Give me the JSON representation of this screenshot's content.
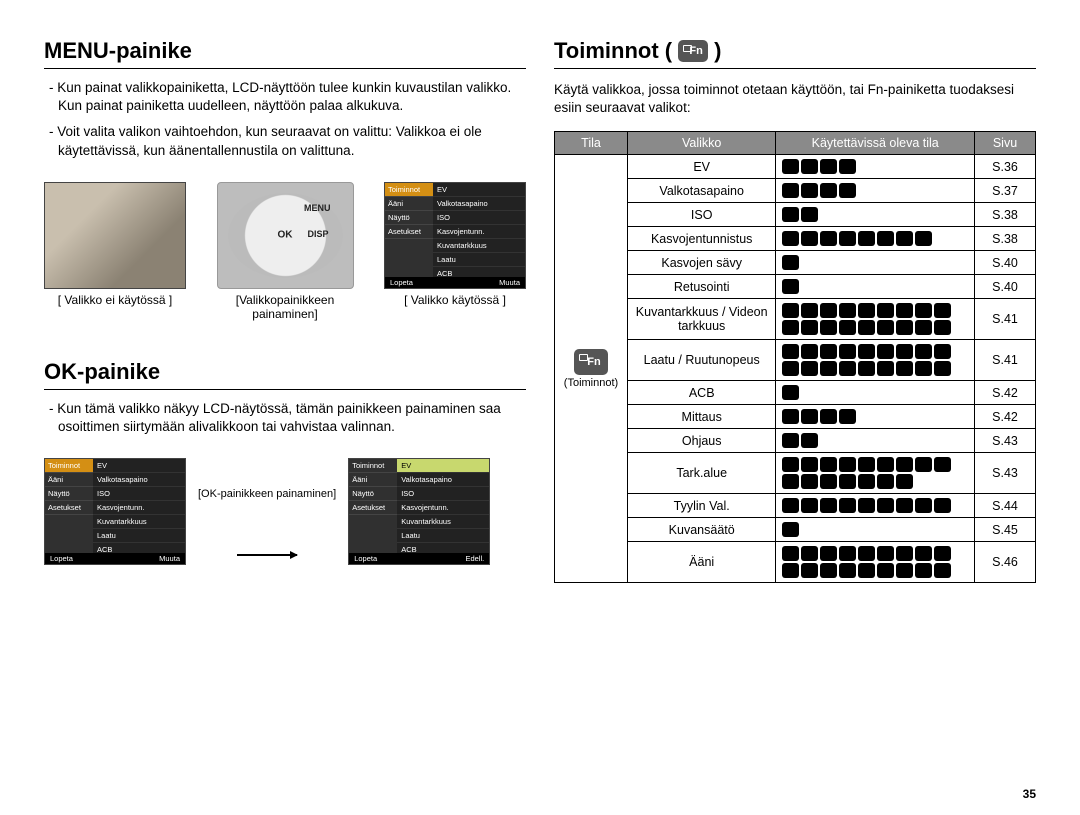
{
  "page_number": "35",
  "left": {
    "menu_heading": "MENU-painike",
    "menu_p1": "- Kun painat valikkopainiketta, LCD-näyttöön tulee kunkin kuvaustilan valikko. Kun painat painiketta uudelleen, näyttöön palaa alkukuva.",
    "menu_p2": "- Voit valita valikon vaihtoehdon, kun seuraavat on valittu: Valikkoa ei ole käytettävissä, kun äänentallennustila on valittuna.",
    "lcd_nomenu_caption": "[ Valikko ei käytössä ]",
    "dial_caption": "[Valikkopainikkeen painaminen]",
    "lcd_menu_caption": "[ Valikko käytössä ]",
    "dial_menu": "MENU",
    "dial_disp": "DISP",
    "dial_ok": "OK",
    "menu_side": [
      "Toiminnot",
      "Ääni",
      "Näyttö",
      "Asetukset"
    ],
    "menu_items": [
      "EV",
      "Valkotasapaino",
      "ISO",
      "Kasvojentunn.",
      "Kuvantarkkuus",
      "Laatu",
      "ACB"
    ],
    "menu_foot_left": "Lopeta",
    "menu_foot_right": "Muuta",
    "ok_heading": "OK-painike",
    "ok_p1": "- Kun tämä valikko näkyy LCD-näytössä, tämän painikkeen painaminen saa osoittimen siirtymään alivalikkoon tai vahvistaa valinnan.",
    "ok_arrow_caption": "[OK-painikkeen painaminen]",
    "ok_menu2_foot_right": "Edell.",
    "menu2_items": [
      "EV",
      "Valkotasapaino",
      "ISO",
      "Kasvojentunn.",
      "Kuvantarkkuus",
      "Laatu",
      "ACB"
    ]
  },
  "right": {
    "heading": "Toiminnot (",
    "heading_suffix": ")",
    "intro": "Käytä valikkoa, jossa toiminnot otetaan käyttöön, tai Fn-painiketta tuodaksesi esiin seuraavat valikot:",
    "headers": {
      "tila": "Tila",
      "valikko": "Valikko",
      "modes": "Käytettävissä oleva tila",
      "sivu": "Sivu"
    },
    "tila_label": "(Toiminnot)",
    "rows": [
      {
        "valikko": "EV",
        "icons": 4,
        "sivu": "S.36"
      },
      {
        "valikko": "Valkotasapaino",
        "icons": 4,
        "sivu": "S.37"
      },
      {
        "valikko": "ISO",
        "icons": 2,
        "sivu": "S.38"
      },
      {
        "valikko": "Kasvojentunnistus",
        "icons": 8,
        "sivu": "S.38"
      },
      {
        "valikko": "Kasvojen sävy",
        "icons": 1,
        "sivu": "S.40"
      },
      {
        "valikko": "Retusointi",
        "icons": 1,
        "sivu": "S.40"
      },
      {
        "valikko": "Kuvantarkkuus / Videon tarkkuus",
        "icons": 18,
        "sivu": "S.41"
      },
      {
        "valikko": "Laatu / Ruutunopeus",
        "icons": 18,
        "sivu": "S.41"
      },
      {
        "valikko": "ACB",
        "icons": 1,
        "sivu": "S.42"
      },
      {
        "valikko": "Mittaus",
        "icons": 4,
        "sivu": "S.42"
      },
      {
        "valikko": "Ohjaus",
        "icons": 2,
        "sivu": "S.43"
      },
      {
        "valikko": "Tark.alue",
        "icons": 16,
        "sivu": "S.43"
      },
      {
        "valikko": "Tyylin Val.",
        "icons": 9,
        "sivu": "S.44"
      },
      {
        "valikko": "Kuvansäätö",
        "icons": 1,
        "sivu": "S.45"
      },
      {
        "valikko": "Ääni",
        "icons": 18,
        "sivu": "S.46"
      }
    ]
  }
}
